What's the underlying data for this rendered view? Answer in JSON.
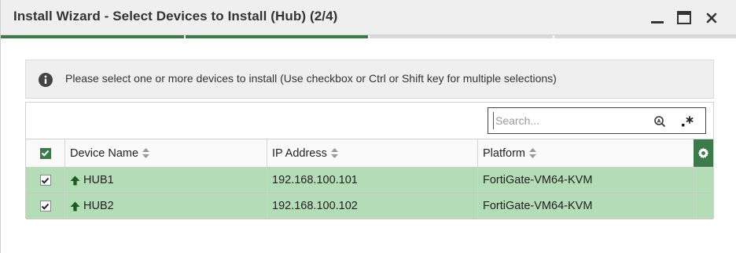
{
  "window": {
    "title": "Install Wizard - Select Devices to Install (Hub) (2/4)",
    "progress_steps": 4,
    "progress_done": 2
  },
  "info": {
    "text": "Please select one or more devices to install (Use checkbox or Ctrl or Shift key for multiple selections)"
  },
  "search": {
    "placeholder": "Search..."
  },
  "table": {
    "columns": [
      "Device Name",
      "IP Address",
      "Platform"
    ],
    "rows": [
      {
        "name": "HUB1",
        "ip": "192.168.100.101",
        "platform": "FortiGate-VM64-KVM",
        "checked": true
      },
      {
        "name": "HUB2",
        "ip": "192.168.100.102",
        "platform": "FortiGate-VM64-KVM",
        "checked": true
      }
    ]
  },
  "colors": {
    "accent": "#3d7a4b",
    "row_selected": "#b4dcb6"
  }
}
